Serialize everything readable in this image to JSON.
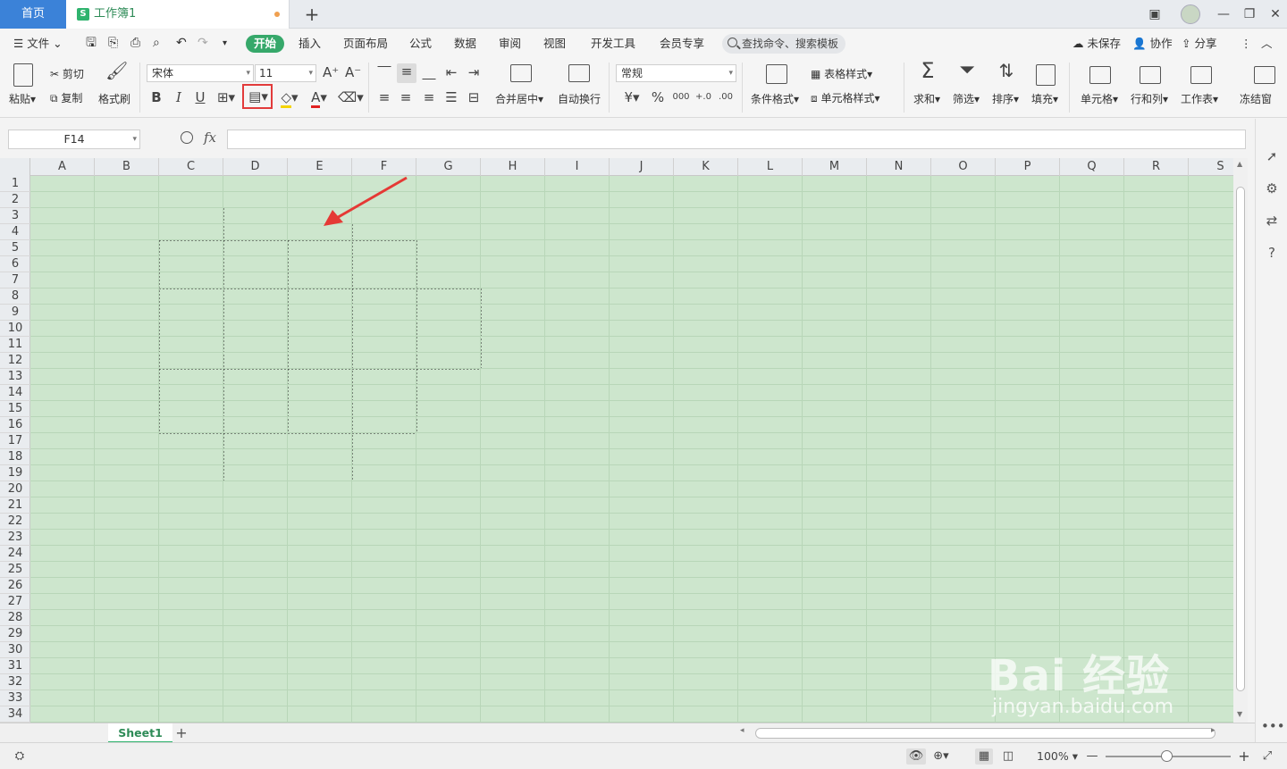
{
  "tabs": {
    "home": "首页",
    "document": "工作簿1",
    "doc_icon": "S"
  },
  "menu": {
    "file": "文件",
    "items": [
      "开始",
      "插入",
      "页面布局",
      "公式",
      "数据",
      "审阅",
      "视图",
      "开发工具",
      "会员专享"
    ],
    "search": "查找命令、搜索模板",
    "unsaved": "未保存",
    "collab": "协作",
    "share": "分享"
  },
  "ribbon": {
    "paste": "粘贴",
    "cut": "剪切",
    "copy": "复制",
    "format_painter": "格式刷",
    "font": "宋体",
    "font_size": "11",
    "merge_center": "合并居中",
    "wrap_text": "自动换行",
    "number_format": "常规",
    "cond_format": "条件格式",
    "table_style": "表格样式",
    "cell_style": "单元格样式",
    "sum": "求和",
    "filter": "筛选",
    "sort": "排序",
    "fill": "填充",
    "cell": "单元格",
    "row_col": "行和列",
    "worksheet": "工作表",
    "freeze": "冻结窗"
  },
  "formula_bar": {
    "name_box": "F14",
    "fx": "fx",
    "value": ""
  },
  "columns": [
    "A",
    "B",
    "C",
    "D",
    "E",
    "F",
    "G",
    "H",
    "I",
    "J",
    "K",
    "L",
    "M",
    "N",
    "O",
    "P",
    "Q",
    "R",
    "S"
  ],
  "rows": [
    "1",
    "2",
    "3",
    "4",
    "5",
    "6",
    "7",
    "8",
    "9",
    "10",
    "11",
    "12",
    "13",
    "14",
    "15",
    "16",
    "17",
    "18",
    "19",
    "20",
    "21",
    "22",
    "23",
    "24",
    "25",
    "26",
    "27",
    "28",
    "29",
    "30",
    "31",
    "32",
    "33",
    "34"
  ],
  "sheets": {
    "active": "Sheet1"
  },
  "status": {
    "zoom": "100%"
  },
  "watermark": {
    "brand": "Bai  经验",
    "url": "jingyan.baidu.com"
  },
  "colors": {
    "accent": "#2fb36e",
    "home_tab": "#3b82d8",
    "sheet_bg": "#cde6cd",
    "highlight": "#e23b3b"
  }
}
